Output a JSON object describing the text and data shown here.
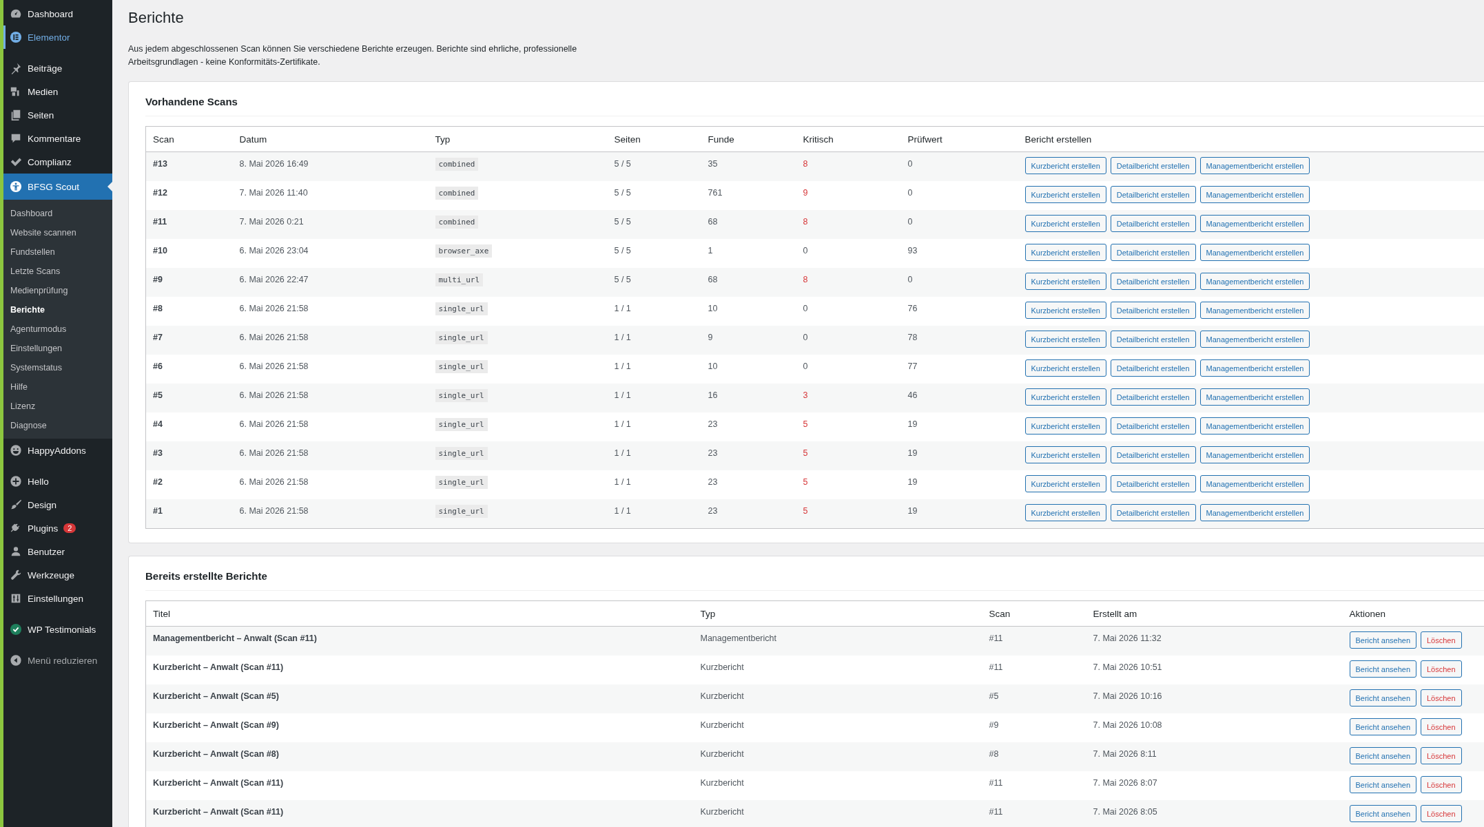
{
  "sidebar": {
    "groups": [
      [
        {
          "label": "Dashboard",
          "selected": false,
          "highlight": false
        },
        {
          "label": "Elementor",
          "selected": false,
          "highlight": true
        }
      ],
      [
        {
          "label": "Beiträge",
          "selected": false,
          "highlight": false
        },
        {
          "label": "Medien",
          "selected": false,
          "highlight": false
        },
        {
          "label": "Seiten",
          "selected": false,
          "highlight": false
        },
        {
          "label": "Kommentare",
          "selected": false,
          "highlight": false
        },
        {
          "label": "Complianz",
          "selected": false,
          "highlight": false
        },
        {
          "label": "BFSG Scout",
          "selected": true,
          "highlight": false,
          "children": [
            {
              "label": "Dashboard",
              "selected": false
            },
            {
              "label": "Website scannen",
              "selected": false
            },
            {
              "label": "Fundstellen",
              "selected": false
            },
            {
              "label": "Letzte Scans",
              "selected": false
            },
            {
              "label": "Medienprüfung",
              "selected": false
            },
            {
              "label": "Berichte",
              "selected": true
            },
            {
              "label": "Agenturmodus",
              "selected": false
            },
            {
              "label": "Einstellungen",
              "selected": false
            },
            {
              "label": "Systemstatus",
              "selected": false
            },
            {
              "label": "Hilfe",
              "selected": false
            },
            {
              "label": "Lizenz",
              "selected": false
            },
            {
              "label": "Diagnose",
              "selected": false
            }
          ]
        },
        {
          "label": "HappyAddons",
          "selected": false,
          "highlight": false
        }
      ],
      [
        {
          "label": "Hello",
          "selected": false,
          "highlight": false
        },
        {
          "label": "Design",
          "selected": false,
          "highlight": false
        },
        {
          "label": "Plugins",
          "selected": false,
          "highlight": false,
          "badge": "2"
        },
        {
          "label": "Benutzer",
          "selected": false,
          "highlight": false
        },
        {
          "label": "Werkzeuge",
          "selected": false,
          "highlight": false
        },
        {
          "label": "Einstellungen",
          "selected": false,
          "highlight": false
        }
      ],
      [
        {
          "label": "WP Testimonials",
          "selected": false,
          "highlight": false
        }
      ]
    ],
    "collapse_button": {
      "label": "Menü reduzieren"
    }
  },
  "page": {
    "title": "Berichte",
    "description": "Aus jedem abgeschlossenen Scan können Sie verschiedene Berichte erzeugen. Berichte sind ehrliche, professionelle Arbeitsgrundlagen - keine Konformitäts-Zertifikate."
  },
  "scans": {
    "title": "Vorhandene Scans",
    "columns": [
      "Scan",
      "Datum",
      "Typ",
      "Seiten",
      "Funde",
      "Kritisch",
      "Prüfwert",
      "Bericht erstellen"
    ],
    "rows": [
      {
        "scan": "#13",
        "datum": "8. Mai 2026 16:49",
        "typ": "combined",
        "seiten": "5 / 5",
        "funde": "35",
        "kritisch": "8",
        "critical": true,
        "pruefwert": "0",
        "actions": [
          "Kurzbericht erstellen",
          "Detailbericht erstellen",
          "Managementbericht erstellen"
        ]
      },
      {
        "scan": "#12",
        "datum": "7. Mai 2026 11:40",
        "typ": "combined",
        "seiten": "5 / 5",
        "funde": "761",
        "kritisch": "9",
        "critical": true,
        "pruefwert": "0",
        "actions": [
          "Kurzbericht erstellen",
          "Detailbericht erstellen",
          "Managementbericht erstellen"
        ]
      },
      {
        "scan": "#11",
        "datum": "7. Mai 2026 0:21",
        "typ": "combined",
        "seiten": "5 / 5",
        "funde": "68",
        "kritisch": "8",
        "critical": true,
        "pruefwert": "0",
        "actions": [
          "Kurzbericht erstellen",
          "Detailbericht erstellen",
          "Managementbericht erstellen"
        ]
      },
      {
        "scan": "#10",
        "datum": "6. Mai 2026 23:04",
        "typ": "browser_axe",
        "seiten": "5 / 5",
        "funde": "1",
        "kritisch": "0",
        "critical": false,
        "pruefwert": "93",
        "actions": [
          "Kurzbericht erstellen",
          "Detailbericht erstellen",
          "Managementbericht erstellen"
        ]
      },
      {
        "scan": "#9",
        "datum": "6. Mai 2026 22:47",
        "typ": "multi_url",
        "seiten": "5 / 5",
        "funde": "68",
        "kritisch": "8",
        "critical": true,
        "pruefwert": "0",
        "actions": [
          "Kurzbericht erstellen",
          "Detailbericht erstellen",
          "Managementbericht erstellen"
        ]
      },
      {
        "scan": "#8",
        "datum": "6. Mai 2026 21:58",
        "typ": "single_url",
        "seiten": "1 / 1",
        "funde": "10",
        "kritisch": "0",
        "critical": false,
        "pruefwert": "76",
        "actions": [
          "Kurzbericht erstellen",
          "Detailbericht erstellen",
          "Managementbericht erstellen"
        ]
      },
      {
        "scan": "#7",
        "datum": "6. Mai 2026 21:58",
        "typ": "single_url",
        "seiten": "1 / 1",
        "funde": "9",
        "kritisch": "0",
        "critical": false,
        "pruefwert": "78",
        "actions": [
          "Kurzbericht erstellen",
          "Detailbericht erstellen",
          "Managementbericht erstellen"
        ]
      },
      {
        "scan": "#6",
        "datum": "6. Mai 2026 21:58",
        "typ": "single_url",
        "seiten": "1 / 1",
        "funde": "10",
        "kritisch": "0",
        "critical": false,
        "pruefwert": "77",
        "actions": [
          "Kurzbericht erstellen",
          "Detailbericht erstellen",
          "Managementbericht erstellen"
        ]
      },
      {
        "scan": "#5",
        "datum": "6. Mai 2026 21:58",
        "typ": "single_url",
        "seiten": "1 / 1",
        "funde": "16",
        "kritisch": "3",
        "critical": true,
        "pruefwert": "46",
        "actions": [
          "Kurzbericht erstellen",
          "Detailbericht erstellen",
          "Managementbericht erstellen"
        ]
      },
      {
        "scan": "#4",
        "datum": "6. Mai 2026 21:58",
        "typ": "single_url",
        "seiten": "1 / 1",
        "funde": "23",
        "kritisch": "5",
        "critical": true,
        "pruefwert": "19",
        "actions": [
          "Kurzbericht erstellen",
          "Detailbericht erstellen",
          "Managementbericht erstellen"
        ]
      },
      {
        "scan": "#3",
        "datum": "6. Mai 2026 21:58",
        "typ": "single_url",
        "seiten": "1 / 1",
        "funde": "23",
        "kritisch": "5",
        "critical": true,
        "pruefwert": "19",
        "actions": [
          "Kurzbericht erstellen",
          "Detailbericht erstellen",
          "Managementbericht erstellen"
        ]
      },
      {
        "scan": "#2",
        "datum": "6. Mai 2026 21:58",
        "typ": "single_url",
        "seiten": "1 / 1",
        "funde": "23",
        "kritisch": "5",
        "critical": true,
        "pruefwert": "19",
        "actions": [
          "Kurzbericht erstellen",
          "Detailbericht erstellen",
          "Managementbericht erstellen"
        ]
      },
      {
        "scan": "#1",
        "datum": "6. Mai 2026 21:58",
        "typ": "single_url",
        "seiten": "1 / 1",
        "funde": "23",
        "kritisch": "5",
        "critical": true,
        "pruefwert": "19",
        "actions": [
          "Kurzbericht erstellen",
          "Detailbericht erstellen",
          "Managementbericht erstellen"
        ]
      }
    ]
  },
  "reports": {
    "title": "Bereits erstellte Berichte",
    "columns": [
      "Titel",
      "Typ",
      "Scan",
      "Erstellt am",
      "Aktionen"
    ],
    "rows": [
      {
        "titel": "Managementbericht – Anwalt (Scan #11)",
        "typ": "Managementbericht",
        "scan": "#11",
        "erstellt": "7. Mai 2026 11:32",
        "actions": [
          {
            "label": "Bericht ansehen",
            "kind": "view"
          },
          {
            "label": "Löschen",
            "kind": "delete"
          }
        ]
      },
      {
        "titel": "Kurzbericht – Anwalt (Scan #11)",
        "typ": "Kurzbericht",
        "scan": "#11",
        "erstellt": "7. Mai 2026 10:51",
        "actions": [
          {
            "label": "Bericht ansehen",
            "kind": "view"
          },
          {
            "label": "Löschen",
            "kind": "delete"
          }
        ]
      },
      {
        "titel": "Kurzbericht – Anwalt (Scan #5)",
        "typ": "Kurzbericht",
        "scan": "#5",
        "erstellt": "7. Mai 2026 10:16",
        "actions": [
          {
            "label": "Bericht ansehen",
            "kind": "view"
          },
          {
            "label": "Löschen",
            "kind": "delete"
          }
        ]
      },
      {
        "titel": "Kurzbericht – Anwalt (Scan #9)",
        "typ": "Kurzbericht",
        "scan": "#9",
        "erstellt": "7. Mai 2026 10:08",
        "actions": [
          {
            "label": "Bericht ansehen",
            "kind": "view"
          },
          {
            "label": "Löschen",
            "kind": "delete"
          }
        ]
      },
      {
        "titel": "Kurzbericht – Anwalt (Scan #8)",
        "typ": "Kurzbericht",
        "scan": "#8",
        "erstellt": "7. Mai 2026 8:11",
        "actions": [
          {
            "label": "Bericht ansehen",
            "kind": "view"
          },
          {
            "label": "Löschen",
            "kind": "delete"
          }
        ]
      },
      {
        "titel": "Kurzbericht – Anwalt (Scan #11)",
        "typ": "Kurzbericht",
        "scan": "#11",
        "erstellt": "7. Mai 2026 8:07",
        "actions": [
          {
            "label": "Bericht ansehen",
            "kind": "view"
          },
          {
            "label": "Löschen",
            "kind": "delete"
          }
        ]
      },
      {
        "titel": "Kurzbericht – Anwalt (Scan #11)",
        "typ": "Kurzbericht",
        "scan": "#11",
        "erstellt": "7. Mai 2026 8:05",
        "actions": [
          {
            "label": "Bericht ansehen",
            "kind": "view"
          },
          {
            "label": "Löschen",
            "kind": "delete"
          }
        ]
      }
    ]
  }
}
